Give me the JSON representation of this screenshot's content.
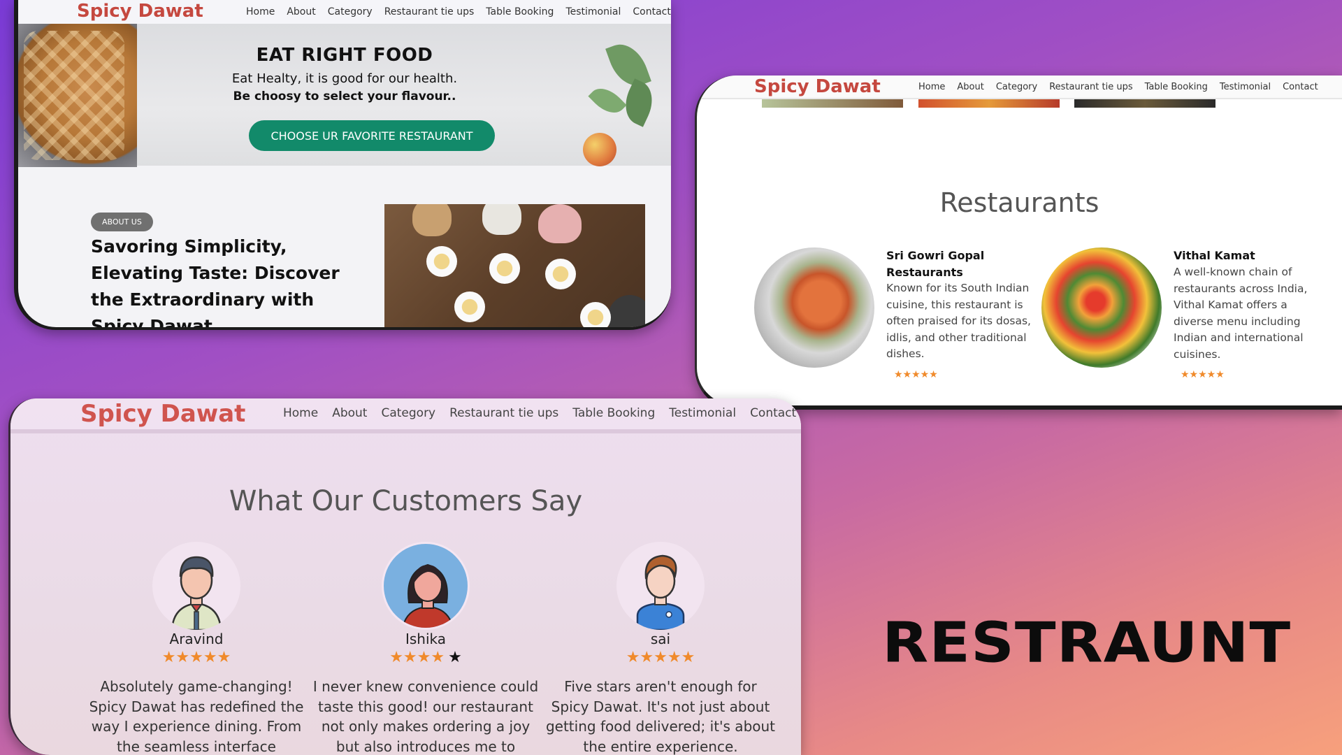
{
  "brand": "Spicy Dawat",
  "nav": [
    "Home",
    "About",
    "Category",
    "Restaurant tie ups",
    "Table Booking",
    "Testimonial",
    "Contact"
  ],
  "hero": {
    "title": "EAT RIGHT FOOD",
    "subtitle": "Eat Healty, it is good for our health.",
    "tagline": "Be choosy to select your flavour..",
    "cta": "CHOOSE UR FAVORITE RESTAURANT"
  },
  "about": {
    "badge": "ABOUT US",
    "heading": "Savoring Simplicity, Elevating Taste: Discover the Extraordinary with Spicy Dawat"
  },
  "restaurants": {
    "title": "Restaurants",
    "items": [
      {
        "name": "Sri Gowri Gopal Restaurants",
        "description": "Known for its South Indian cuisine, this restaurant is often praised for its dosas, idlis, and other traditional dishes.",
        "rating": 5,
        "stars": "★★★★★"
      },
      {
        "name": "Vithal Kamat",
        "description": "A well-known chain of restaurants across India, Vithal Kamat offers a diverse menu including Indian and international cuisines.",
        "rating": 5,
        "stars": "★★★★★"
      }
    ]
  },
  "testimonials": {
    "title": "What Our Customers Say",
    "items": [
      {
        "name": "Aravind",
        "rating": 5,
        "stars_filled": "★★★★★",
        "stars_empty": "",
        "review": "Absolutely game-changing! Spicy Dawat has redefined the way I experience dining. From the seamless interface"
      },
      {
        "name": "Ishika",
        "rating": 4,
        "stars_filled": "★★★★",
        "stars_empty": "★",
        "review": "I never knew convenience could taste this good! our restaurant not only makes ordering a joy but also introduces me to hidden gems in"
      },
      {
        "name": "sai",
        "rating": 5,
        "stars_filled": "★★★★★",
        "stars_empty": "",
        "review": "Five stars aren't enough for Spicy Dawat. It's not just about getting food delivered; it's about the entire experience."
      }
    ]
  },
  "big_title": "RESTRAUNT",
  "colors": {
    "brand": "#c5483f",
    "cta": "#128a6a",
    "star": "#f08a2b",
    "bg_start": "#7a3bd6",
    "bg_end": "#f7a07c"
  },
  "icons": [
    "man-avatar-icon",
    "woman-avatar-icon",
    "boy-avatar-icon",
    "star-icon"
  ]
}
